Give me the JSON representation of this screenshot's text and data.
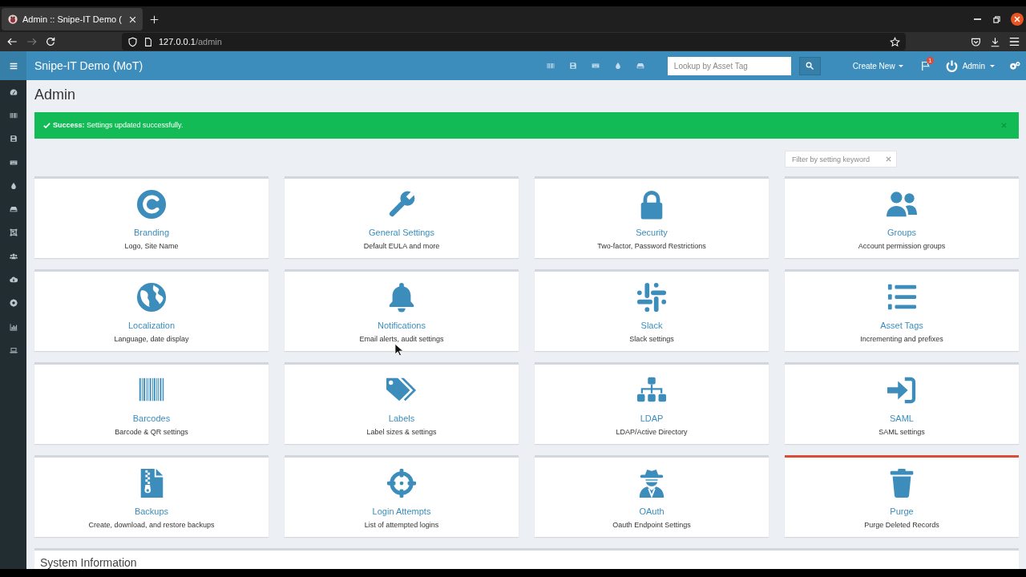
{
  "browser": {
    "tabs": [
      {
        "title": "Admin :: Snipe-IT Demo (",
        "selected": true
      }
    ],
    "navigation": {
      "back_enabled": true,
      "forward_enabled": false
    },
    "url": {
      "host": "127.0.0.1",
      "path": "/admin"
    }
  },
  "navbar": {
    "brand": "Snipe-IT Demo (MoT)",
    "search": {
      "placeholder": "Lookup by Asset Tag"
    },
    "create_new": "Create New",
    "notifications": {
      "count": "1"
    },
    "user": "Admin"
  },
  "page": {
    "title": "Admin",
    "alert": {
      "kind": "success",
      "text": "**Success:** Settings updated successfully."
    },
    "filter": {
      "placeholder": "Filter by setting keyword"
    },
    "settings": [
      {
        "title": "Branding",
        "description": "Logo, Site Name",
        "danger": false
      },
      {
        "title": "General Settings",
        "description": "Default EULA and more",
        "danger": false
      },
      {
        "title": "Security",
        "description": "Two-factor, Password Restrictions",
        "danger": false
      },
      {
        "title": "Groups",
        "description": "Account permission groups",
        "danger": false
      },
      {
        "title": "Localization",
        "description": "Language, date display",
        "danger": false
      },
      {
        "title": "Notifications",
        "description": "Email alerts, audit settings",
        "danger": false
      },
      {
        "title": "Slack",
        "description": "Slack settings",
        "danger": false
      },
      {
        "title": "Asset Tags",
        "description": "Incrementing and prefixes",
        "danger": false
      },
      {
        "title": "Barcodes",
        "description": "Barcode & QR settings",
        "danger": false
      },
      {
        "title": "Labels",
        "description": "Label sizes & settings",
        "danger": false
      },
      {
        "title": "LDAP",
        "description": "LDAP/Active Directory",
        "danger": false
      },
      {
        "title": "SAML",
        "description": "SAML settings",
        "danger": false
      },
      {
        "title": "Backups",
        "description": "Create, download, and restore backups",
        "danger": false
      },
      {
        "title": "Login Attempts",
        "description": "List of attempted logins",
        "danger": false
      },
      {
        "title": "OAuth",
        "description": "Oauth Endpoint Settings",
        "danger": false
      },
      {
        "title": "Purge",
        "description": "Purge Deleted Records",
        "danger": true
      }
    ],
    "system_information": {
      "title": "System Information"
    }
  }
}
